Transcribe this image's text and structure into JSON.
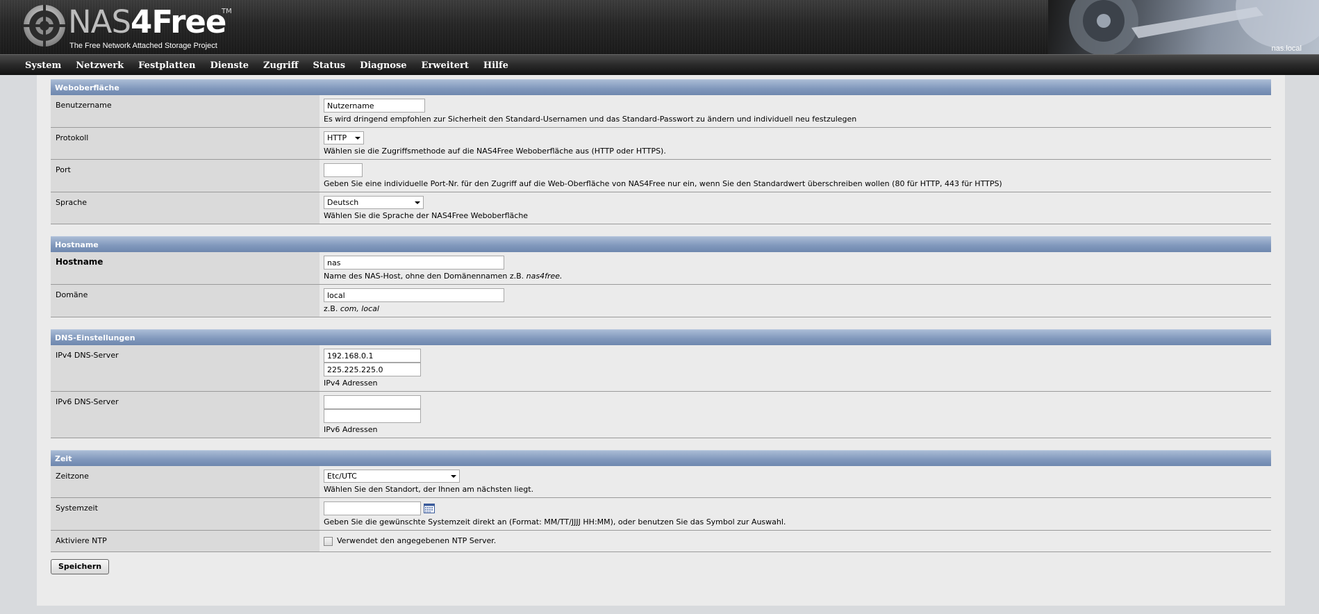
{
  "header": {
    "logo_part1": "NAS",
    "logo_part2": "4Free",
    "logo_tm": "TM",
    "tagline": "The Free Network Attached Storage Project",
    "hostname": "nas.local"
  },
  "nav": {
    "items": [
      "System",
      "Netzwerk",
      "Festplatten",
      "Dienste",
      "Zugriff",
      "Status",
      "Diagnose",
      "Erweitert",
      "Hilfe"
    ]
  },
  "webui": {
    "title": "Weboberfläche",
    "username_label": "Benutzername",
    "username_value": "Nutzername",
    "username_hint": "Es wird dringend empfohlen zur Sicherheit den Standard-Usernamen und das Standard-Passwort zu ändern und individuell neu festzulegen",
    "protocol_label": "Protokoll",
    "protocol_value": "HTTP",
    "protocol_hint": "Wählen sie die Zugriffsmethode auf die NAS4Free Weboberfläche aus (HTTP oder HTTPS).",
    "port_label": "Port",
    "port_value": "",
    "port_hint": "Geben Sie eine individuelle Port-Nr. für den Zugriff auf die Web-Oberfläche von NAS4Free nur ein, wenn Sie den Standardwert überschreiben wollen (80 für HTTP, 443 für HTTPS)",
    "language_label": "Sprache",
    "language_value": "Deutsch",
    "language_hint": "Wählen Sie die Sprache der NAS4Free Weboberfläche"
  },
  "hostname": {
    "title": "Hostname",
    "host_label": "Hostname",
    "host_value": "nas",
    "host_hint_prefix": "Name des NAS-Host, ohne den Domänennamen z.B. ",
    "host_hint_example": "nas4free.",
    "domain_label": "Domäne",
    "domain_value": "local",
    "domain_hint_prefix": "z.B. ",
    "domain_hint_example": "com, local"
  },
  "dns": {
    "title": "DNS-Einstellungen",
    "ipv4_label": "IPv4 DNS-Server",
    "ipv4_values": [
      "192.168.0.1",
      "225.225.225.0"
    ],
    "ipv4_hint": "IPv4 Adressen",
    "ipv6_label": "IPv6 DNS-Server",
    "ipv6_values": [
      "",
      ""
    ],
    "ipv6_hint": "IPv6 Adressen"
  },
  "time": {
    "title": "Zeit",
    "tz_label": "Zeitzone",
    "tz_value": "Etc/UTC",
    "tz_hint": "Wählen Sie den Standort, der Ihnen am nächsten liegt.",
    "systime_label": "Systemzeit",
    "systime_value": "",
    "systime_hint": "Geben Sie die gewünschte Systemzeit direkt an (Format: MM/TT/JJJJ HH:MM), oder benutzen Sie das Symbol zur Auswahl.",
    "ntp_label": "Aktiviere NTP",
    "ntp_checked": false,
    "ntp_hint": "Verwendet den angegebenen NTP Server."
  },
  "save_label": "Speichern"
}
